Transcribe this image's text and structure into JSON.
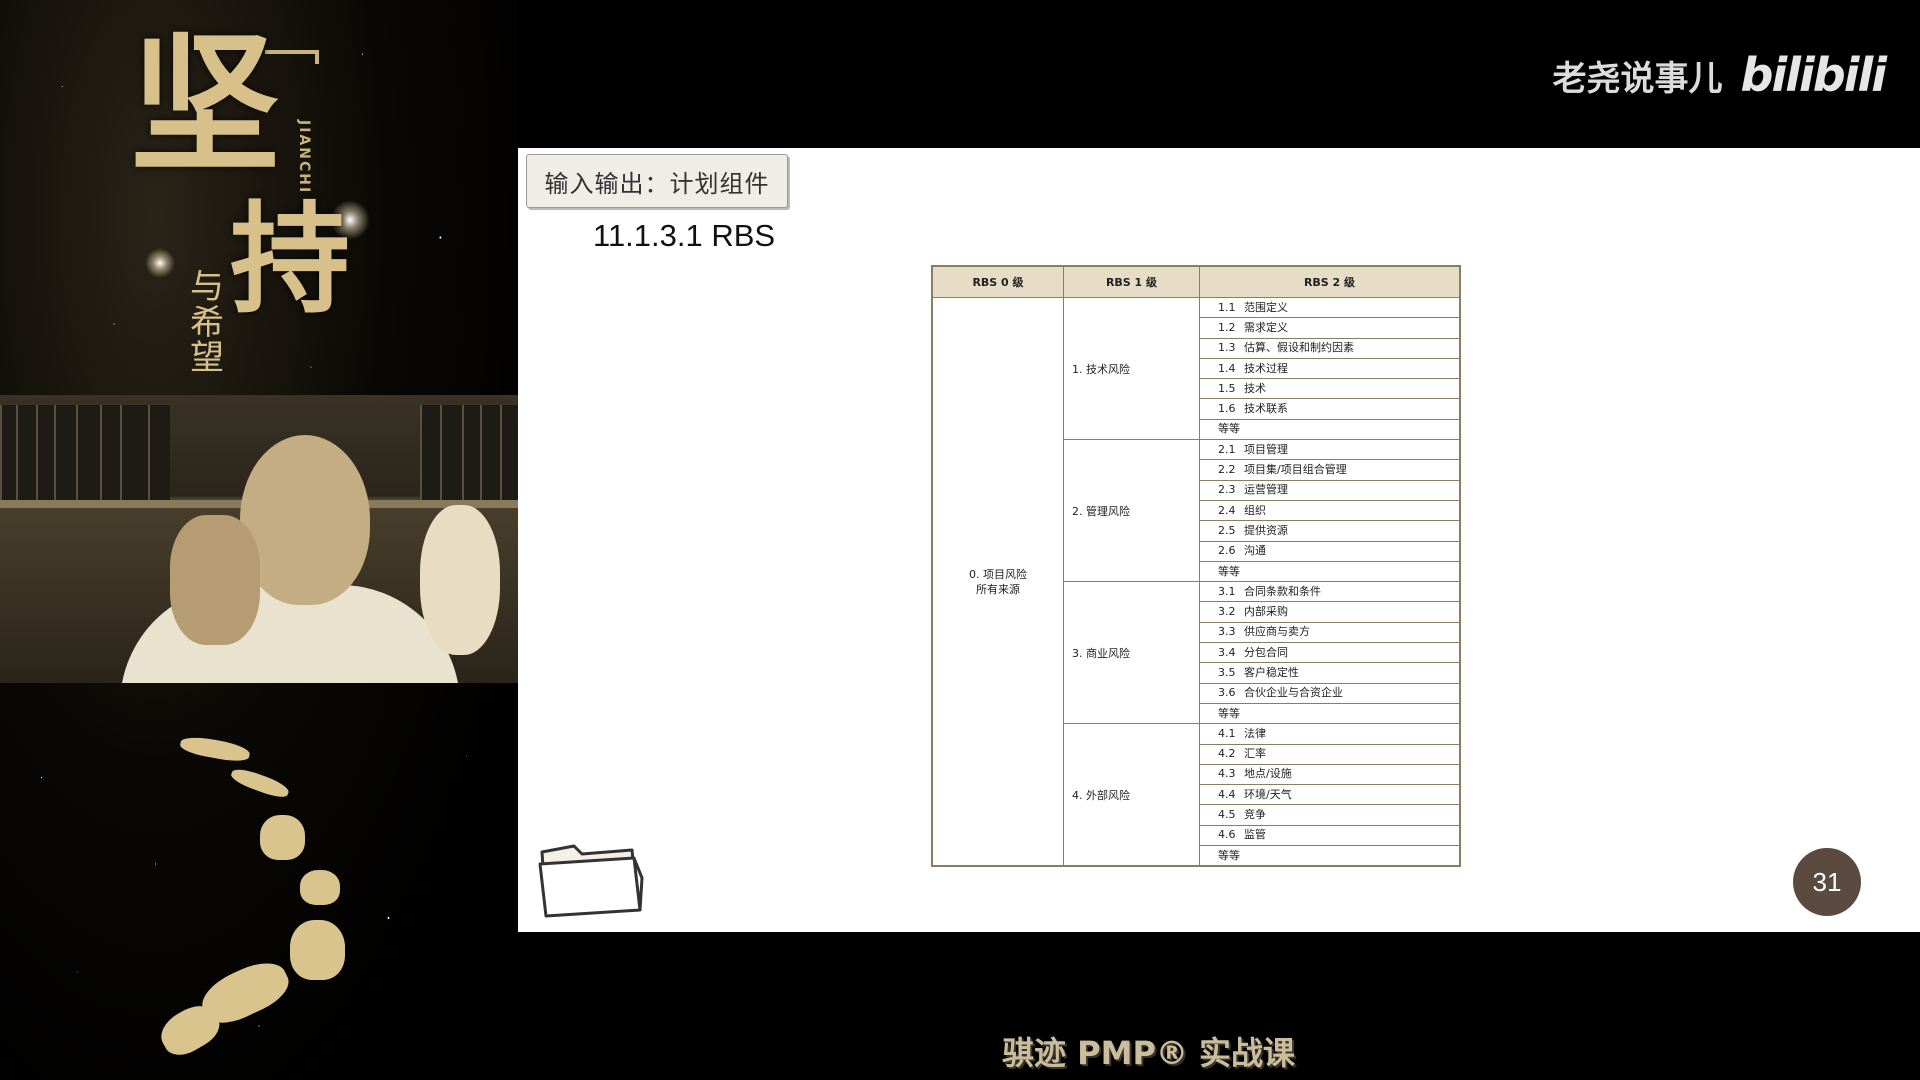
{
  "poster": {
    "title_char_1": "坚",
    "title_char_2": "持",
    "subtitle": "与希望",
    "pinyin": "JIANCHI"
  },
  "brand": {
    "name": "老尧说事儿",
    "logo_text": "bilibili"
  },
  "slide": {
    "section_tab": "输入输出：计划组件",
    "heading": "11.1.3.1 RBS",
    "page_number": "31"
  },
  "rbs_table": {
    "headers": [
      "RBS 0 级",
      "RBS 1 级",
      "RBS 2 级"
    ],
    "level0": {
      "line1": "0. 项目风险",
      "line2": "所有来源"
    },
    "groups": [
      {
        "label": "1. 技术风险",
        "items": [
          {
            "code": "1.1",
            "text": "范围定义"
          },
          {
            "code": "1.2",
            "text": "需求定义"
          },
          {
            "code": "1.3",
            "text": "估算、假设和制约因素"
          },
          {
            "code": "1.4",
            "text": "技术过程"
          },
          {
            "code": "1.5",
            "text": "技术"
          },
          {
            "code": "1.6",
            "text": "技术联系"
          },
          {
            "code": "",
            "text": "等等"
          }
        ]
      },
      {
        "label": "2. 管理风险",
        "items": [
          {
            "code": "2.1",
            "text": "项目管理"
          },
          {
            "code": "2.2",
            "text": "项目集/项目组合管理"
          },
          {
            "code": "2.3",
            "text": "运营管理"
          },
          {
            "code": "2.4",
            "text": "组织"
          },
          {
            "code": "2.5",
            "text": "提供资源"
          },
          {
            "code": "2.6",
            "text": "沟通"
          },
          {
            "code": "",
            "text": "等等"
          }
        ]
      },
      {
        "label": "3. 商业风险",
        "items": [
          {
            "code": "3.1",
            "text": "合同条款和条件"
          },
          {
            "code": "3.2",
            "text": "内部采购"
          },
          {
            "code": "3.3",
            "text": "供应商与卖方"
          },
          {
            "code": "3.4",
            "text": "分包合同"
          },
          {
            "code": "3.5",
            "text": "客户稳定性"
          },
          {
            "code": "3.6",
            "text": "合伙企业与合资企业"
          },
          {
            "code": "",
            "text": "等等"
          }
        ]
      },
      {
        "label": "4. 外部风险",
        "items": [
          {
            "code": "4.1",
            "text": "法律"
          },
          {
            "code": "4.2",
            "text": "汇率"
          },
          {
            "code": "4.3",
            "text": "地点/设施"
          },
          {
            "code": "4.4",
            "text": "环境/天气"
          },
          {
            "code": "4.5",
            "text": "竞争"
          },
          {
            "code": "4.6",
            "text": "监管"
          },
          {
            "code": "",
            "text": "等等"
          }
        ]
      }
    ]
  },
  "footer": {
    "course_label": "骐迹 PMP® 实战课"
  },
  "icons": {
    "folder": "folder-icon"
  }
}
